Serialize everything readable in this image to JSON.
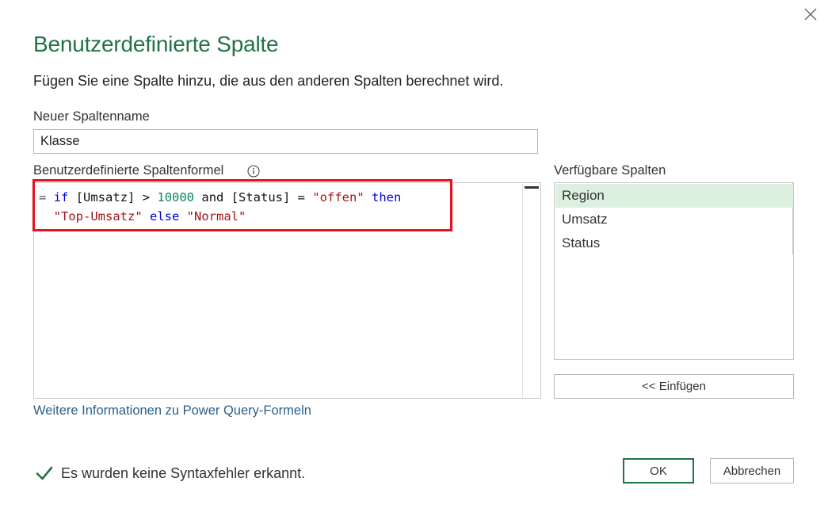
{
  "dialog": {
    "title": "Benutzerdefinierte Spalte",
    "subtitle": "Fügen Sie eine Spalte hinzu, die aus den anderen Spalten berechnet wird.",
    "close_icon": "close-icon"
  },
  "column_name": {
    "label": "Neuer Spaltenname",
    "value": "Klasse"
  },
  "formula": {
    "label": "Benutzerdefinierte Spaltenformel",
    "info_icon": "info-icon",
    "line1": {
      "eq": "=",
      "if": "if",
      "field1": "[Umsatz] > ",
      "num": "10000",
      "and": " and [Status] = ",
      "str1": "\"offen\"",
      "then": "then"
    },
    "line2": {
      "str2": "\"Top-Umsatz\"",
      "else": "else",
      "str3": "\"Normal\""
    },
    "highlight_color": "#e8101e"
  },
  "available_columns": {
    "label": "Verfügbare Spalten",
    "items": [
      "Region",
      "Umsatz",
      "Status"
    ],
    "selected": "Region",
    "insert_button": "<< Einfügen"
  },
  "help_link": "Weitere Informationen zu Power Query-Formeln",
  "status": {
    "icon": "checkmark-icon",
    "text": "Es wurden keine Syntaxfehler erkannt."
  },
  "buttons": {
    "ok": "OK",
    "cancel": "Abbrechen"
  },
  "colors": {
    "accent": "#217346",
    "selected_row": "#ddefdf",
    "link": "#2c5f8a"
  }
}
